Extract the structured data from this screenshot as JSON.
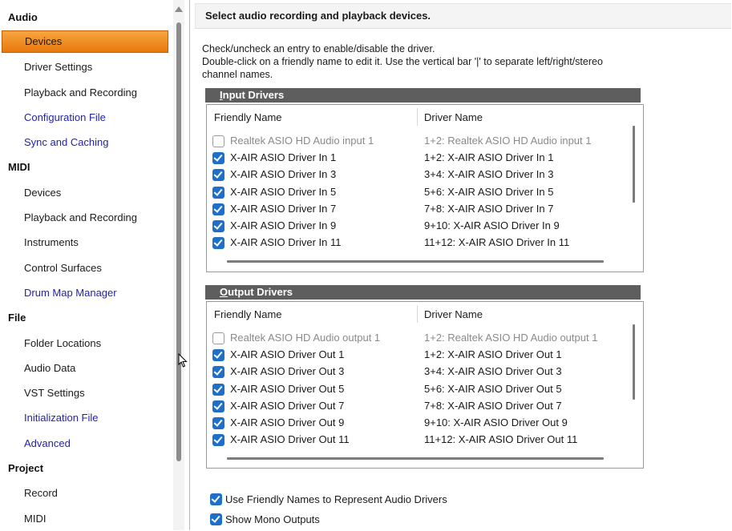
{
  "sidebar": {
    "sections": [
      {
        "label": "Audio",
        "items": [
          {
            "label": "Devices",
            "selected": true,
            "link": false
          },
          {
            "label": "Driver Settings",
            "link": false
          },
          {
            "label": "Playback and Recording",
            "link": false
          },
          {
            "label": "Configuration File",
            "link": true
          },
          {
            "label": "Sync and Caching",
            "link": true
          }
        ]
      },
      {
        "label": "MIDI",
        "items": [
          {
            "label": "Devices",
            "link": false
          },
          {
            "label": "Playback and Recording",
            "link": false
          },
          {
            "label": "Instruments",
            "link": false
          },
          {
            "label": "Control Surfaces",
            "link": false
          },
          {
            "label": "Drum Map Manager",
            "link": true
          }
        ]
      },
      {
        "label": "File",
        "items": [
          {
            "label": "Folder Locations",
            "link": false
          },
          {
            "label": "Audio Data",
            "link": false
          },
          {
            "label": "VST Settings",
            "link": false
          },
          {
            "label": "Initialization File",
            "link": true
          },
          {
            "label": "Advanced",
            "link": true
          }
        ]
      },
      {
        "label": "Project",
        "items": [
          {
            "label": "Record",
            "link": false
          },
          {
            "label": "MIDI",
            "link": false
          }
        ]
      }
    ]
  },
  "header": {
    "title": "Select audio recording and playback devices."
  },
  "instructions": {
    "line1": "Check/uncheck an entry to enable/disable the driver.",
    "line2": "Double-click on a friendly name to edit it. Use the vertical bar '|' to separate left/right/stereo",
    "line3": "channel names."
  },
  "input_drivers": {
    "title": "Input Drivers",
    "col_friendly": "Friendly Name",
    "col_driver": "Driver Name",
    "rows": [
      {
        "friendly": "Realtek ASIO HD Audio input 1",
        "driver": "1+2: Realtek ASIO HD Audio input 1",
        "checked": false
      },
      {
        "friendly": "X-AIR ASIO Driver In 1",
        "driver": "1+2: X-AIR ASIO Driver In 1",
        "checked": true
      },
      {
        "friendly": "X-AIR ASIO Driver In 3",
        "driver": "3+4: X-AIR ASIO Driver In 3",
        "checked": true
      },
      {
        "friendly": "X-AIR ASIO Driver In 5",
        "driver": "5+6: X-AIR ASIO Driver In 5",
        "checked": true
      },
      {
        "friendly": "X-AIR ASIO Driver In 7",
        "driver": "7+8: X-AIR ASIO Driver In 7",
        "checked": true
      },
      {
        "friendly": "X-AIR ASIO Driver In 9",
        "driver": "9+10: X-AIR ASIO Driver In 9",
        "checked": true
      },
      {
        "friendly": "X-AIR ASIO Driver In 11",
        "driver": "11+12: X-AIR ASIO Driver In 11",
        "checked": true
      }
    ]
  },
  "output_drivers": {
    "title": "Output Drivers",
    "col_friendly": "Friendly Name",
    "col_driver": "Driver Name",
    "rows": [
      {
        "friendly": "Realtek ASIO HD Audio output 1",
        "driver": "1+2: Realtek ASIO HD Audio output 1",
        "checked": false
      },
      {
        "friendly": "X-AIR ASIO Driver Out 1",
        "driver": "1+2: X-AIR ASIO Driver Out 1",
        "checked": true
      },
      {
        "friendly": "X-AIR ASIO Driver Out 3",
        "driver": "3+4: X-AIR ASIO Driver Out 3",
        "checked": true
      },
      {
        "friendly": "X-AIR ASIO Driver Out 5",
        "driver": "5+6: X-AIR ASIO Driver Out 5",
        "checked": true
      },
      {
        "friendly": "X-AIR ASIO Driver Out 7",
        "driver": "7+8: X-AIR ASIO Driver Out 7",
        "checked": true
      },
      {
        "friendly": "X-AIR ASIO Driver Out 9",
        "driver": "9+10: X-AIR ASIO Driver Out 9",
        "checked": true
      },
      {
        "friendly": "X-AIR ASIO Driver Out 11",
        "driver": "11+12: X-AIR ASIO Driver Out 11",
        "checked": true
      }
    ]
  },
  "options": [
    {
      "label": "Use Friendly Names to Represent Audio Drivers",
      "checked": true
    },
    {
      "label": "Show Mono Outputs",
      "checked": true
    }
  ],
  "colors": {
    "selected": "#f08a1c",
    "link": "#2323a8",
    "checkbox": "#1e6fc9",
    "group_header": "#5e5e5e"
  },
  "icons": {
    "cursor": "arrow-cursor-icon",
    "scroll_up": "scroll-up-arrow-icon"
  }
}
